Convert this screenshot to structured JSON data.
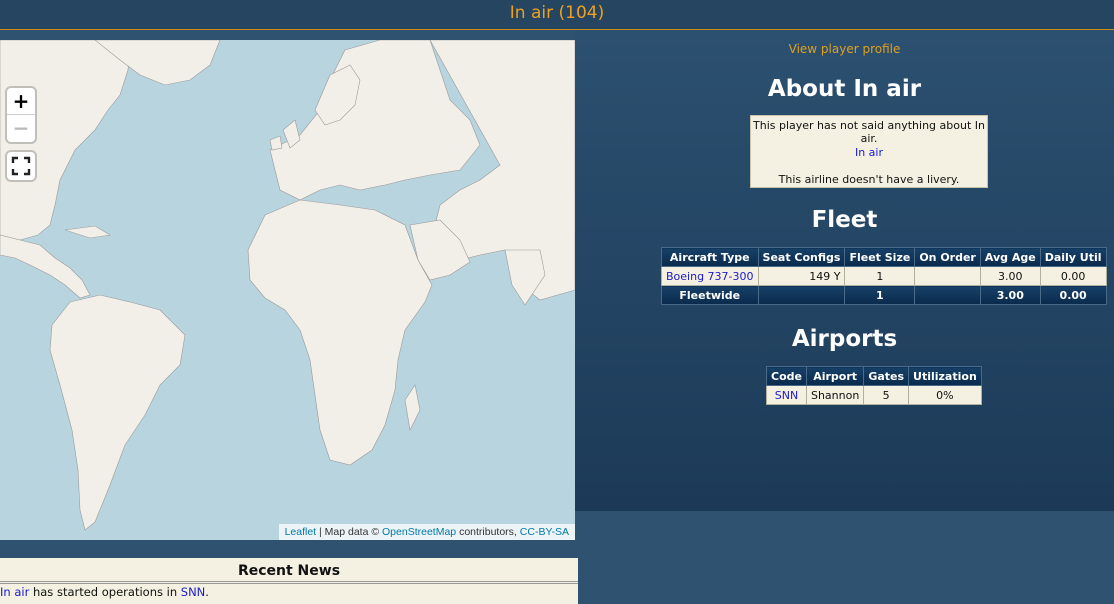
{
  "header": {
    "title": "In air (104)"
  },
  "map": {
    "zoom_in": "+",
    "zoom_out": "−",
    "attribution": {
      "leaflet": "Leaflet",
      "sep1": " | Map data © ",
      "osm": "OpenStreetMap",
      "contributors": " contributors, ",
      "license": "CC-BY-SA"
    }
  },
  "profile": {
    "view_profile": "View player profile",
    "about_heading": "About In air",
    "about_text": "This player has not said anything about In air.",
    "airline_link": "In air",
    "livery_text": "This airline doesn't have a livery."
  },
  "fleet": {
    "heading": "Fleet",
    "columns": [
      "Aircraft Type",
      "Seat Configs",
      "Fleet Size",
      "On Order",
      "Avg Age",
      "Daily Util"
    ],
    "rows": [
      {
        "aircraft": "Boeing 737-300",
        "seats": "149 Y",
        "size": "1",
        "on_order": "",
        "avg_age": "3.00",
        "util": "0.00"
      }
    ],
    "footer": {
      "label": "Fleetwide",
      "seats": "",
      "size": "1",
      "on_order": "",
      "avg_age": "3.00",
      "util": "0.00"
    }
  },
  "airports": {
    "heading": "Airports",
    "columns": [
      "Code",
      "Airport",
      "Gates",
      "Utilization"
    ],
    "rows": [
      {
        "code": "SNN",
        "airport": "Shannon",
        "gates": "5",
        "utilization": "0%"
      }
    ]
  },
  "news": {
    "heading": "Recent News",
    "item": {
      "airline": "In air",
      "text": " has started operations in ",
      "airport": "SNN",
      "end": "."
    }
  },
  "colors": {
    "background": "#2e5270",
    "accent": "#f0a020",
    "link": "#1a1acc",
    "table_header": "#0a2a4c",
    "table_cell": "#f4f1e2",
    "ocean": "#b8d4df",
    "land": "#f2efe9"
  },
  "icons": {
    "fullscreen": "fullscreen-icon"
  }
}
